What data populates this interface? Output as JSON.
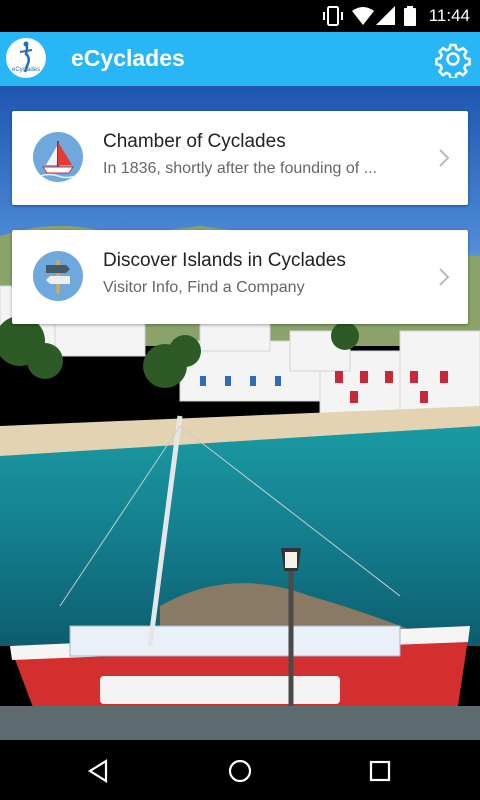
{
  "status_bar": {
    "time": "11:44"
  },
  "app_bar": {
    "title": "eCyclades",
    "logo_text": "eCyclades",
    "settings_icon": "gear-icon"
  },
  "cards": [
    {
      "title": "Chamber of Cyclades",
      "subtitle": "In 1836, shortly after the founding of ...",
      "icon": "sailboat-icon"
    },
    {
      "title": "Discover Islands in Cyclades",
      "subtitle": "Visitor Info, Find a Company",
      "icon": "signpost-icon"
    }
  ],
  "colors": {
    "app_bar": "#29B6F6",
    "icon_circle": "#6FA8DC"
  }
}
